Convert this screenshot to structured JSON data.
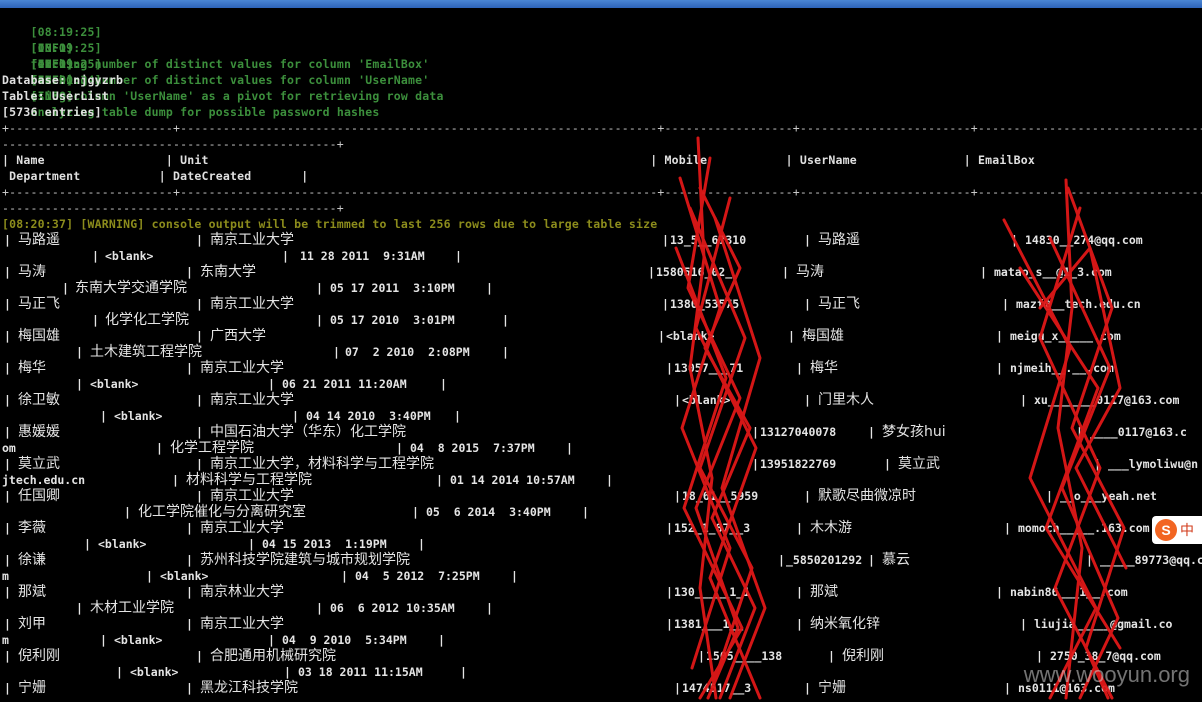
{
  "window": {
    "title": ""
  },
  "log": [
    {
      "time": "[08:19:25]",
      "level": "[INFO]",
      "msg": "fetching number of distinct values for column 'EmailBox'"
    },
    {
      "time": "[08:19:25]",
      "level": "[INFO]",
      "msg": "fetching number of distinct values for column 'UserName'"
    },
    {
      "time": "[08:19:25]",
      "level": "[INFO]",
      "msg": "using column 'UserName' as a pivot for retrieving row data"
    },
    {
      "time": "[08:20:34]",
      "level": "[INFO]",
      "msg": "analyzing table dump for possible password hashes"
    }
  ],
  "dump": {
    "database": "Database: njgyzrb",
    "table": "Table: UserList",
    "entries": "[5736 entries]"
  },
  "table": {
    "headers": [
      "Name",
      "Unit",
      "Mobile",
      "UserName",
      "EmailBox",
      "Department",
      "DateCreated"
    ],
    "warning": "[08:20:37] [WARNING] console output will be trimmed to last 256 rows due to large table size"
  },
  "rows": [
    {
      "name": "马路遥",
      "unit": "南京工业大学",
      "mobile": "13_5__67310",
      "username": "马路遥",
      "email": "14830__274@qq.com",
      "dept": "<blank>",
      "date": "11 28 2011  9:31AM"
    },
    {
      "name": "马涛",
      "unit": "东南大学",
      "mobile": "1580516_02_",
      "username": "马涛",
      "email": "matao_s__@1_3.com",
      "dept": "东南大学交通学院",
      "date": "05 17 2011  3:10PM"
    },
    {
      "name": "马正飞",
      "unit": "南京工业大学",
      "mobile": "1380_53575",
      "username": "马正飞",
      "email": "mazf@__tech.edu.cn",
      "dept": "化学化工学院",
      "date": "05 17 2010  3:01PM"
    },
    {
      "name": "梅国雄",
      "unit": "广西大学",
      "mobile": "<blank>",
      "username": "梅国雄",
      "email": "meigu_x_____.com",
      "dept": "土木建筑工程学院",
      "date": "07  2 2010  2:08PM"
    },
    {
      "name": "梅华",
      "unit": "南京工业大学",
      "mobile": "13057___71",
      "username": "梅华",
      "email": "njmeih__.__.com",
      "dept": "<blank>",
      "date": "06 21 2011 11:20AM"
    },
    {
      "name": "徐卫敏",
      "unit": "南京工业大学",
      "mobile": "<blank>",
      "username": "门里木人",
      "email": "xu_______0117@163.com",
      "dept": "<blank>",
      "date": "04 14 2010  3:40PM"
    },
    {
      "name": "惠媛媛",
      "unit": "中国石油大学（华东）化工学院",
      "mobile": "13127040078",
      "username": "梦女孩hui",
      "email": "____0117@163.c",
      "dept": "化学工程学院",
      "date": "04  8 2015  7:37PM",
      "email_prefix": "om"
    },
    {
      "name": "莫立武",
      "unit": "南京工业大学，材料科学与工程学院",
      "mobile": "13951822769",
      "username": "莫立武",
      "email": "___lymoliwu@n",
      "dept": "材料科学与工程学院",
      "date": "01 14 2014 10:57AM",
      "email_prefix": "jtech.edu.cn"
    },
    {
      "name": "任国卿",
      "unit": "南京工业大学",
      "mobile": "18_61__5959",
      "username": "默歌尽曲微凉时",
      "email": "__o___yeah.net",
      "dept": "化工学院催化与分离研究室",
      "date": "05  6 2014  3:40PM"
    },
    {
      "name": "李薇",
      "unit": "南京工业大学",
      "mobile": "152_1_87__3",
      "username": "木木游",
      "email": "momoch_____.163.com",
      "dept": "<blank>",
      "date": "04 15 2013  1:19PM"
    },
    {
      "name": "徐谦",
      "unit": "苏州科技学院建筑与城市规划学院",
      "mobile": "_5850201292",
      "username": "慕云",
      "email": "_____89773@qq.co",
      "dept": "<blank>",
      "date": "04  5 2012  7:25PM",
      "email_prefix": "m"
    },
    {
      "name": "那斌",
      "unit": "南京林业大学",
      "mobile": "130_____1_1",
      "username": "那斌",
      "email": "nabin86___1__.com",
      "dept": "木材工业学院",
      "date": "06  6 2012 10:35AM"
    },
    {
      "name": "刘甲",
      "unit": "南京工业大学",
      "mobile": "1381___1__",
      "username": "纳米氧化锌",
      "email": "liujia_____@gmail.co",
      "dept": "<blank>",
      "date": "04  9 2010  5:34PM",
      "email_prefix": "m"
    },
    {
      "name": "倪利刚",
      "unit": "合肥通用机械研究院",
      "mobile": "1505____138",
      "username": "倪利刚",
      "email": "2750_38_7@qq.com",
      "dept": "<blank>",
      "date": "03 18 2011 11:15AM"
    },
    {
      "name": "宁姗",
      "unit": "黑龙江科技学院",
      "mobile": "1474517__3",
      "username": "宁姗",
      "email": "ns0111@163.com",
      "dept": "",
      "date": ""
    }
  ],
  "ime": {
    "label": "中"
  },
  "watermark": "www.wooyun.org",
  "colors": {
    "info": "#3c8f3c",
    "warning": "#8c8c1c",
    "text": "#e0e0e0",
    "redaction": "#e01818"
  }
}
